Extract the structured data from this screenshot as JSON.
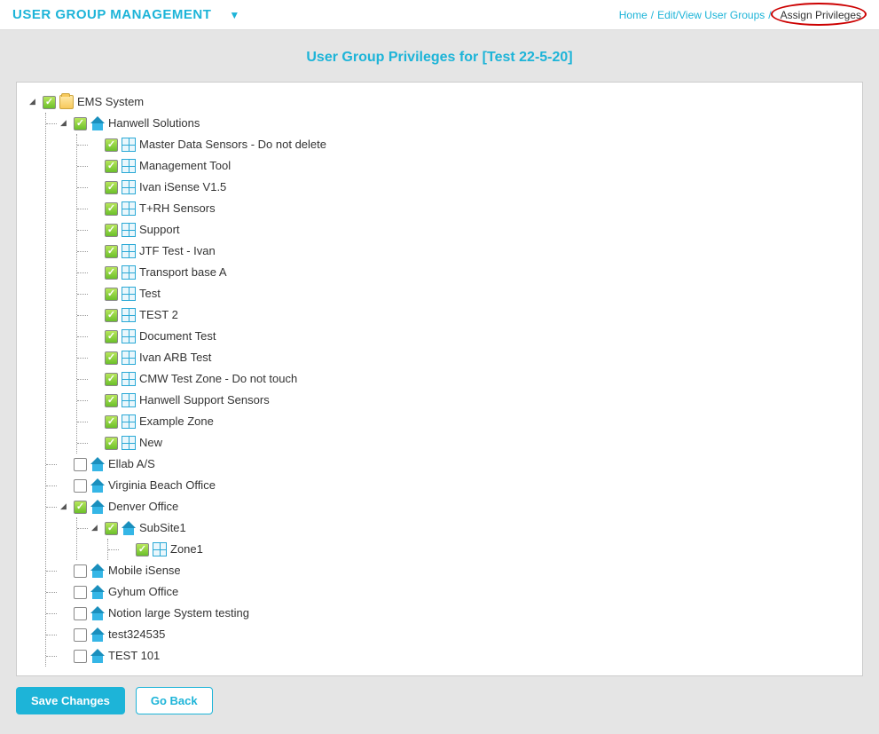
{
  "header": {
    "title": "USER GROUP MANAGEMENT"
  },
  "breadcrumb": {
    "home": "Home",
    "edit_view": "Edit/View User Groups",
    "assign": "Assign Privileges"
  },
  "subtitle": "User Group Privileges for [Test 22-5-20]",
  "tree": {
    "root": {
      "label": "EMS System",
      "checked": true,
      "icon": "folder"
    },
    "hanwell": {
      "label": "Hanwell Solutions",
      "checked": true,
      "icon": "house"
    },
    "hanwell_children": [
      {
        "label": "Master Data Sensors - Do not delete",
        "checked": true
      },
      {
        "label": "Management Tool",
        "checked": true
      },
      {
        "label": "Ivan iSense V1.5",
        "checked": true
      },
      {
        "label": "T+RH Sensors",
        "checked": true
      },
      {
        "label": "Support",
        "checked": true
      },
      {
        "label": "JTF Test - Ivan",
        "checked": true
      },
      {
        "label": "Transport base A",
        "checked": true
      },
      {
        "label": "Test",
        "checked": true
      },
      {
        "label": "TEST 2",
        "checked": true
      },
      {
        "label": "Document Test",
        "checked": true
      },
      {
        "label": "Ivan ARB Test",
        "checked": true
      },
      {
        "label": "CMW Test Zone - Do not touch",
        "checked": true
      },
      {
        "label": "Hanwell Support Sensors",
        "checked": true
      },
      {
        "label": "Example Zone",
        "checked": true
      },
      {
        "label": "New",
        "checked": true
      }
    ],
    "ellab": {
      "label": "Ellab A/S",
      "checked": false,
      "icon": "house"
    },
    "virginia": {
      "label": "Virginia Beach Office",
      "checked": false,
      "icon": "house"
    },
    "denver": {
      "label": "Denver Office",
      "checked": true,
      "icon": "house"
    },
    "subsite1": {
      "label": "SubSite1",
      "checked": true,
      "icon": "house"
    },
    "zone1": {
      "label": "Zone1",
      "checked": true,
      "icon": "grid"
    },
    "others": [
      {
        "label": "Mobile iSense",
        "checked": false
      },
      {
        "label": "Gyhum Office",
        "checked": false
      },
      {
        "label": "Notion large System testing",
        "checked": false
      },
      {
        "label": "test324535",
        "checked": false
      },
      {
        "label": "TEST 101",
        "checked": false
      }
    ]
  },
  "buttons": {
    "save": "Save Changes",
    "back": "Go Back"
  }
}
